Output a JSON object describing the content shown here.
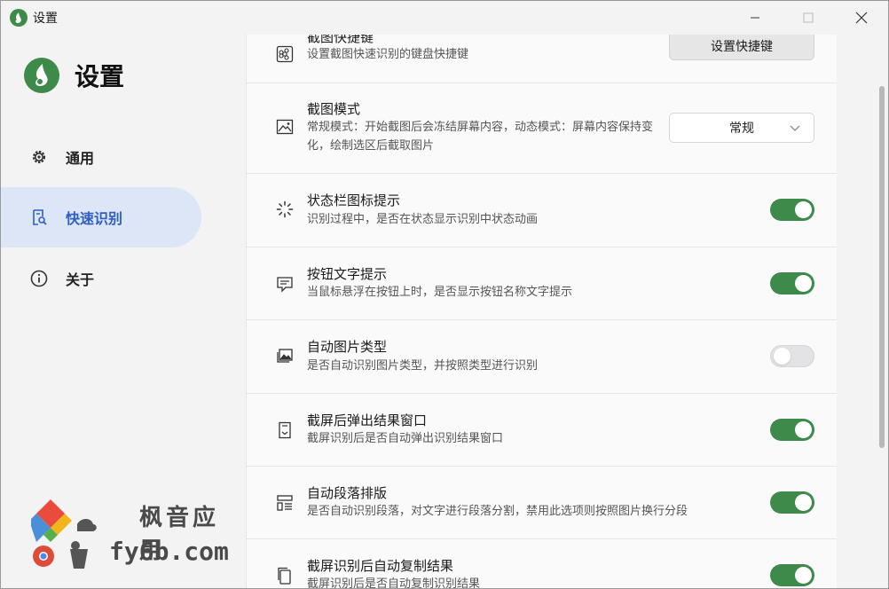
{
  "window": {
    "title": "设置",
    "controls": [
      "minimize",
      "maximize",
      "close"
    ]
  },
  "sidebar": {
    "brand_title": "设置",
    "items": [
      {
        "label": "通用",
        "icon": "gear-icon",
        "active": false
      },
      {
        "label": "快速识别",
        "icon": "document-search-icon",
        "active": true
      },
      {
        "label": "关于",
        "icon": "info-icon",
        "active": false
      }
    ]
  },
  "watermark": {
    "line1": "枫音应用",
    "line2": "fy6b.com"
  },
  "settings": [
    {
      "title": "截图快捷键",
      "desc": "设置截图快速识别的键盘快捷键",
      "icon": "command-key-icon",
      "control": "button",
      "button_label": "设置快捷键"
    },
    {
      "title": "截图模式",
      "desc": "常规模式：开始截图后会冻结屏幕内容，动态模式：屏幕内容保持变化，绘制选区后截取图片",
      "icon": "image-icon",
      "control": "select",
      "select_value": "常规"
    },
    {
      "title": "状态栏图标提示",
      "desc": "识别过程中，是否在状态显示识别中状态动画",
      "icon": "spinner-icon",
      "control": "toggle",
      "on": true
    },
    {
      "title": "按钮文字提示",
      "desc": "当鼠标悬浮在按钮上时，是否显示按钮名称文字提示",
      "icon": "message-icon",
      "control": "toggle",
      "on": true
    },
    {
      "title": "自动图片类型",
      "desc": "是否自动识别图片类型，并按照类型进行识别",
      "icon": "images-icon",
      "control": "toggle",
      "on": false
    },
    {
      "title": "截屏后弹出结果窗口",
      "desc": "截屏识别后是否自动弹出识别结果窗口",
      "icon": "result-doc-icon",
      "control": "toggle",
      "on": true
    },
    {
      "title": "自动段落排版",
      "desc": "是否自动识别段落，对文字进行段落分割，禁用此选项则按照图片换行分段",
      "icon": "layout-icon",
      "control": "toggle",
      "on": true
    },
    {
      "title": "截屏识别后自动复制结果",
      "desc": "截屏识别后是否自动复制识别结果",
      "icon": "copy-icon",
      "control": "toggle",
      "on": true
    }
  ],
  "colors": {
    "accent": "#2f5ec4",
    "toggle_on": "#3d8a4b",
    "nav_active_bg": "#dde6f7"
  }
}
